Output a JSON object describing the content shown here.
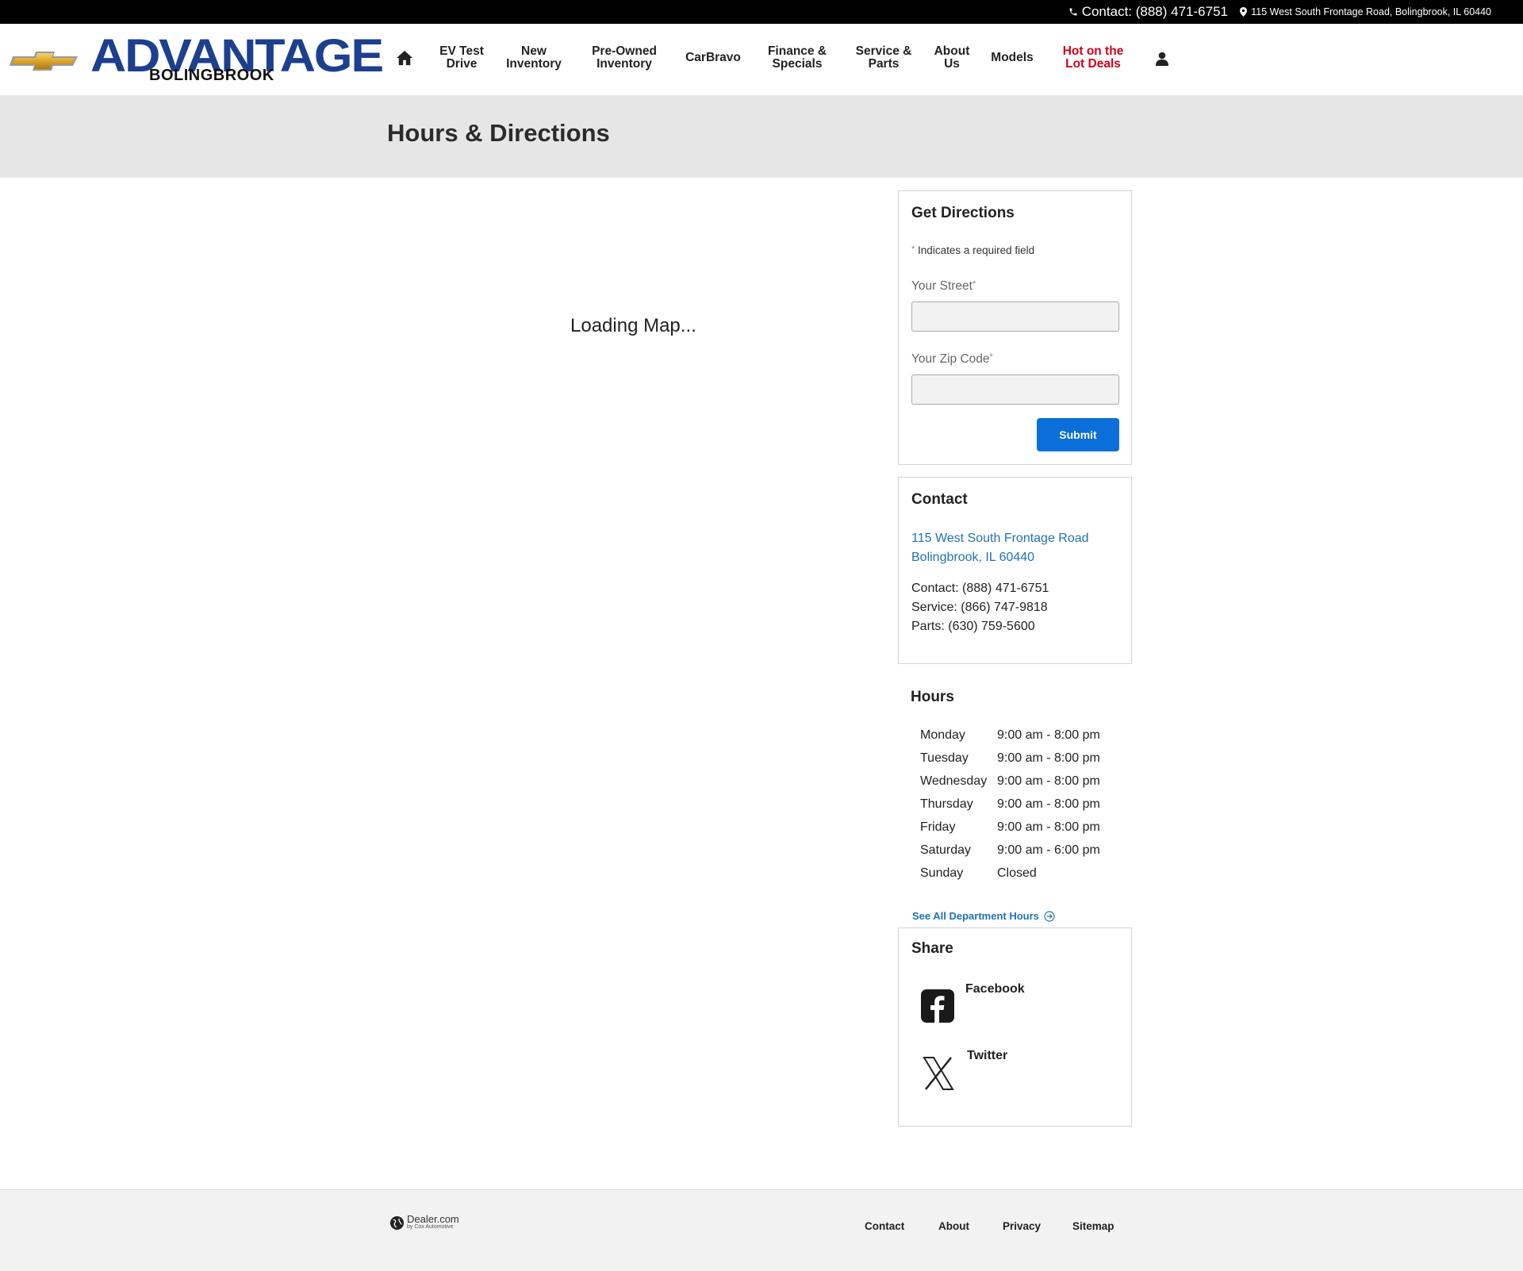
{
  "topbar": {
    "contact": "Contact: (888) 471-6751",
    "address": "115 West South Frontage Road, Bolingbrook, IL 60440"
  },
  "brand": {
    "name": "ADVANTAGE",
    "location": "BOLINGBROOK",
    "brand_color": "#1d3f8f",
    "bowtie_icon": "chevrolet-bowtie-icon"
  },
  "nav": {
    "home_icon": "home-icon",
    "items": [
      {
        "line1": "EV Test",
        "line2": "Drive"
      },
      {
        "line1": "New",
        "line2": "Inventory"
      },
      {
        "line1": "Pre-Owned",
        "line2": "Inventory"
      },
      {
        "line1": "CarBravo",
        "line2": ""
      },
      {
        "line1": "Finance &",
        "line2": "Specials"
      },
      {
        "line1": "Service &",
        "line2": "Parts"
      },
      {
        "line1": "About",
        "line2": "Us"
      },
      {
        "line1": "Models",
        "line2": ""
      },
      {
        "line1": "Hot on the",
        "line2": "Lot Deals"
      }
    ],
    "account_icon": "user-icon",
    "accent_red": "#d0021b"
  },
  "page": {
    "title": "Hours & Directions",
    "map_loading": "Loading Map..."
  },
  "directions": {
    "heading": "Get Directions",
    "required_note": "Indicates a required field",
    "street_label": "Your Street",
    "street_value": "",
    "zip_label": "Your Zip Code",
    "zip_value": "",
    "required_marker": "*",
    "submit_label": "Submit",
    "button_color": "#0a6fd8"
  },
  "contact": {
    "heading": "Contact",
    "address_line1": "115 West South Frontage Road",
    "address_line2": "Bolingbrook, IL 60440",
    "phones": [
      "Contact: (888) 471-6751",
      "Service: (866) 747-9818",
      "Parts: (630) 759-5600"
    ]
  },
  "hours": {
    "heading": "Hours",
    "rows": [
      {
        "day": "Monday",
        "time": "9:00 am - 8:00 pm"
      },
      {
        "day": "Tuesday",
        "time": "9:00 am - 8:00 pm"
      },
      {
        "day": "Wednesday",
        "time": "9:00 am - 8:00 pm"
      },
      {
        "day": "Thursday",
        "time": "9:00 am - 8:00 pm"
      },
      {
        "day": "Friday",
        "time": "9:00 am - 8:00 pm"
      },
      {
        "day": "Saturday",
        "time": "9:00 am - 6:00 pm"
      },
      {
        "day": "Sunday",
        "time": "Closed"
      }
    ],
    "all_departments_link": "See All Department Hours"
  },
  "share": {
    "heading": "Share",
    "facebook": "Facebook",
    "twitter": "Twitter"
  },
  "footer": {
    "provider": "Dealer.com",
    "provider_sub": "by Cox Automotive",
    "links": [
      "Contact",
      "About",
      "Privacy",
      "Sitemap"
    ]
  }
}
